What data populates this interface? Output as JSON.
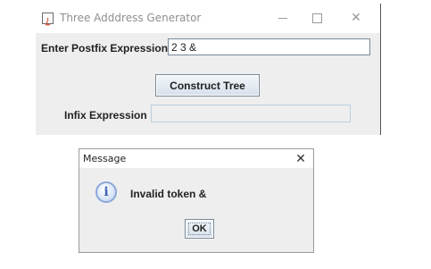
{
  "main_window": {
    "title": "Three Adddress Generator",
    "controls": {
      "minimize": "—",
      "maximize": "☐",
      "close": "✕"
    },
    "postfix_label": "Enter Postfix Expression",
    "postfix_value": "2 3 &",
    "construct_button": "Construct Tree",
    "infix_label": "Infix Expression",
    "infix_value": ""
  },
  "dialog": {
    "title": "Message",
    "close": "✕",
    "icon": "info-icon",
    "message": "Invalid token &",
    "ok_button": "OK"
  }
}
